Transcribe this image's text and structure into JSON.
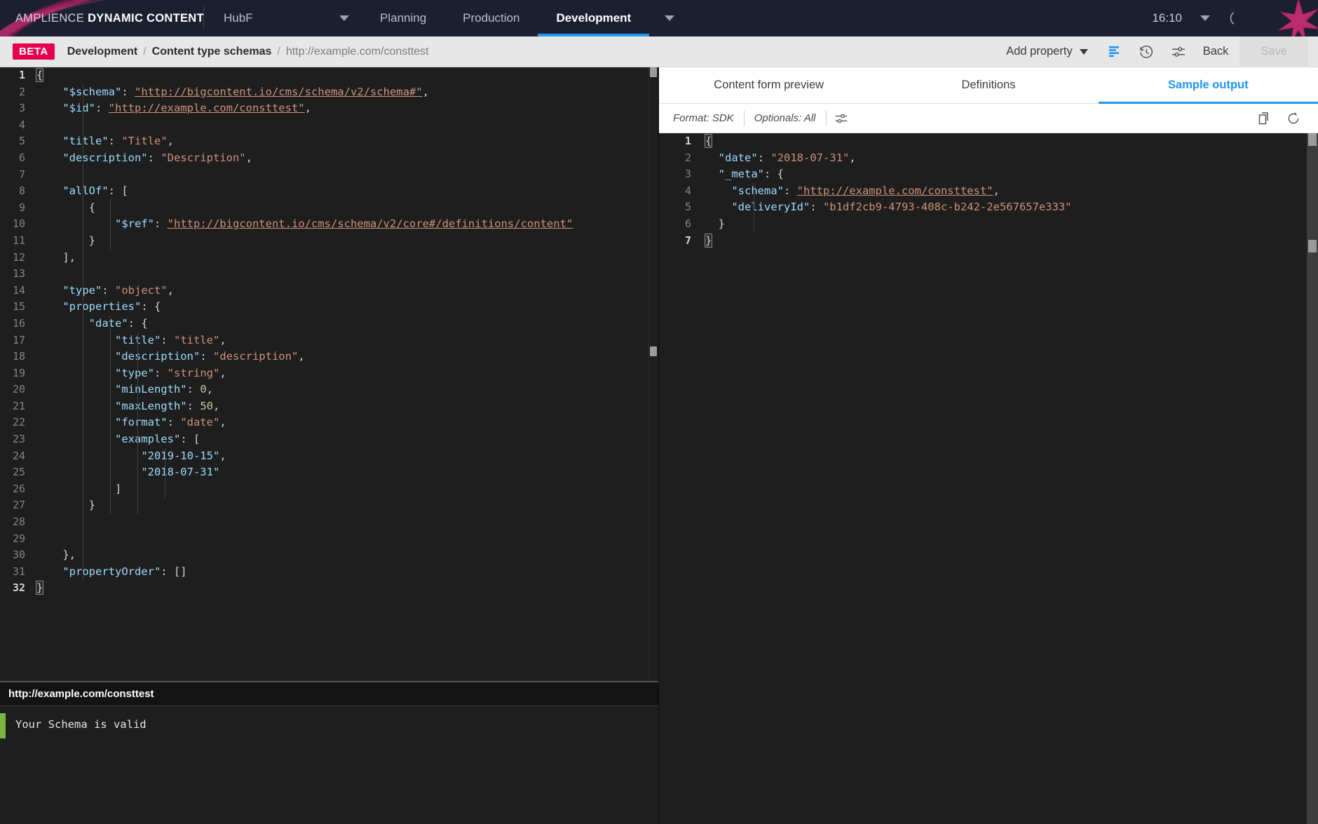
{
  "topbar": {
    "brand_light": "AMPLIENCE",
    "brand_bold": "DYNAMIC CONTENT",
    "hub_label": "HubF",
    "tabs": [
      {
        "label": "Planning",
        "active": false
      },
      {
        "label": "Production",
        "active": false
      },
      {
        "label": "Development",
        "active": true
      }
    ],
    "clock": "16:10",
    "icons": {
      "hub_caret": "chevron-down-icon",
      "tab_caret": "chevron-down-icon",
      "clock_caret": "chevron-down-icon",
      "help": "help-circle-icon",
      "settings": "gear-icon",
      "logout": "logout-icon"
    }
  },
  "actionbar": {
    "badge": "BETA",
    "breadcrumb": [
      {
        "label": "Development",
        "type": "link"
      },
      {
        "label": "Content type schemas",
        "type": "link"
      },
      {
        "label": "http://example.com/consttest",
        "type": "current"
      }
    ],
    "separator": "/",
    "add_property_label": "Add property",
    "back_label": "Back",
    "save_label": "Save",
    "icons": {
      "format": "format-indent-icon",
      "history": "history-clock-icon",
      "settings": "sliders-icon"
    },
    "accent_beta": "#e5004c",
    "accent_format_icon": "#2196f3"
  },
  "editor": {
    "language": "json",
    "total_lines": 32,
    "lines": [
      {
        "n": 1,
        "tokens": [
          {
            "t": "{",
            "c": "brkt"
          }
        ]
      },
      {
        "n": 2,
        "tokens": [
          {
            "t": "    ",
            "c": "p"
          },
          {
            "t": "\"$schema\"",
            "c": "k"
          },
          {
            "t": ": ",
            "c": "p"
          },
          {
            "t": "\"http://bigcontent.io/cms/schema/v2/schema#\"",
            "c": "su"
          },
          {
            "t": ",",
            "c": "p"
          }
        ]
      },
      {
        "n": 3,
        "tokens": [
          {
            "t": "    ",
            "c": "p"
          },
          {
            "t": "\"$id\"",
            "c": "k"
          },
          {
            "t": ": ",
            "c": "p"
          },
          {
            "t": "\"http://example.com/consttest\"",
            "c": "su"
          },
          {
            "t": ",",
            "c": "p"
          }
        ]
      },
      {
        "n": 4,
        "tokens": []
      },
      {
        "n": 5,
        "tokens": [
          {
            "t": "    ",
            "c": "p"
          },
          {
            "t": "\"title\"",
            "c": "k"
          },
          {
            "t": ": ",
            "c": "p"
          },
          {
            "t": "\"Title\"",
            "c": "s"
          },
          {
            "t": ",",
            "c": "p"
          }
        ]
      },
      {
        "n": 6,
        "tokens": [
          {
            "t": "    ",
            "c": "p"
          },
          {
            "t": "\"description\"",
            "c": "k"
          },
          {
            "t": ": ",
            "c": "p"
          },
          {
            "t": "\"Description\"",
            "c": "s"
          },
          {
            "t": ",",
            "c": "p"
          }
        ]
      },
      {
        "n": 7,
        "tokens": []
      },
      {
        "n": 8,
        "tokens": [
          {
            "t": "    ",
            "c": "p"
          },
          {
            "t": "\"allOf\"",
            "c": "k"
          },
          {
            "t": ": [",
            "c": "p"
          }
        ]
      },
      {
        "n": 9,
        "tokens": [
          {
            "t": "        {",
            "c": "p"
          }
        ]
      },
      {
        "n": 10,
        "tokens": [
          {
            "t": "            ",
            "c": "p"
          },
          {
            "t": "\"$ref\"",
            "c": "k"
          },
          {
            "t": ": ",
            "c": "p"
          },
          {
            "t": "\"http://bigcontent.io/cms/schema/v2/core#/definitions/content\"",
            "c": "su"
          }
        ]
      },
      {
        "n": 11,
        "tokens": [
          {
            "t": "        }",
            "c": "p"
          }
        ]
      },
      {
        "n": 12,
        "tokens": [
          {
            "t": "    ],",
            "c": "p"
          }
        ]
      },
      {
        "n": 13,
        "tokens": []
      },
      {
        "n": 14,
        "tokens": [
          {
            "t": "    ",
            "c": "p"
          },
          {
            "t": "\"type\"",
            "c": "k"
          },
          {
            "t": ": ",
            "c": "p"
          },
          {
            "t": "\"object\"",
            "c": "s"
          },
          {
            "t": ",",
            "c": "p"
          }
        ]
      },
      {
        "n": 15,
        "tokens": [
          {
            "t": "    ",
            "c": "p"
          },
          {
            "t": "\"properties\"",
            "c": "k"
          },
          {
            "t": ": {",
            "c": "p"
          }
        ]
      },
      {
        "n": 16,
        "tokens": [
          {
            "t": "        ",
            "c": "p"
          },
          {
            "t": "\"date\"",
            "c": "k"
          },
          {
            "t": ": {",
            "c": "p"
          }
        ]
      },
      {
        "n": 17,
        "tokens": [
          {
            "t": "            ",
            "c": "p"
          },
          {
            "t": "\"title\"",
            "c": "k"
          },
          {
            "t": ": ",
            "c": "p"
          },
          {
            "t": "\"title\"",
            "c": "s"
          },
          {
            "t": ",",
            "c": "p"
          }
        ]
      },
      {
        "n": 18,
        "tokens": [
          {
            "t": "            ",
            "c": "p"
          },
          {
            "t": "\"description\"",
            "c": "k"
          },
          {
            "t": ": ",
            "c": "p"
          },
          {
            "t": "\"description\"",
            "c": "s"
          },
          {
            "t": ",",
            "c": "p"
          }
        ]
      },
      {
        "n": 19,
        "tokens": [
          {
            "t": "            ",
            "c": "p"
          },
          {
            "t": "\"type\"",
            "c": "k"
          },
          {
            "t": ": ",
            "c": "p"
          },
          {
            "t": "\"string\"",
            "c": "s"
          },
          {
            "t": ",",
            "c": "p"
          }
        ]
      },
      {
        "n": 20,
        "tokens": [
          {
            "t": "            ",
            "c": "p"
          },
          {
            "t": "\"minLength\"",
            "c": "k"
          },
          {
            "t": ": ",
            "c": "p"
          },
          {
            "t": "0",
            "c": "n"
          },
          {
            "t": ",",
            "c": "p"
          }
        ]
      },
      {
        "n": 21,
        "tokens": [
          {
            "t": "            ",
            "c": "p"
          },
          {
            "t": "\"maxLength\"",
            "c": "k"
          },
          {
            "t": ": ",
            "c": "p"
          },
          {
            "t": "50",
            "c": "n"
          },
          {
            "t": ",",
            "c": "p"
          }
        ]
      },
      {
        "n": 22,
        "tokens": [
          {
            "t": "            ",
            "c": "p"
          },
          {
            "t": "\"format\"",
            "c": "k"
          },
          {
            "t": ": ",
            "c": "p"
          },
          {
            "t": "\"date\"",
            "c": "s"
          },
          {
            "t": ",",
            "c": "p"
          }
        ]
      },
      {
        "n": 23,
        "tokens": [
          {
            "t": "            ",
            "c": "p"
          },
          {
            "t": "\"examples\"",
            "c": "k"
          },
          {
            "t": ": [",
            "c": "p"
          }
        ]
      },
      {
        "n": 24,
        "tokens": [
          {
            "t": "                ",
            "c": "p"
          },
          {
            "t": "\"2019-10-15\"",
            "c": "sb"
          },
          {
            "t": ",",
            "c": "p"
          }
        ]
      },
      {
        "n": 25,
        "tokens": [
          {
            "t": "                ",
            "c": "p"
          },
          {
            "t": "\"2018-07-31\"",
            "c": "sb"
          }
        ]
      },
      {
        "n": 26,
        "tokens": [
          {
            "t": "            ]",
            "c": "p"
          }
        ]
      },
      {
        "n": 27,
        "tokens": [
          {
            "t": "        }",
            "c": "p"
          }
        ]
      },
      {
        "n": 28,
        "tokens": []
      },
      {
        "n": 29,
        "tokens": []
      },
      {
        "n": 30,
        "tokens": [
          {
            "t": "    },",
            "c": "p"
          }
        ]
      },
      {
        "n": 31,
        "tokens": [
          {
            "t": "    ",
            "c": "p"
          },
          {
            "t": "\"propertyOrder\"",
            "c": "k"
          },
          {
            "t": ": []",
            "c": "p"
          }
        ]
      },
      {
        "n": 32,
        "tokens": [
          {
            "t": "}",
            "c": "brkt"
          }
        ]
      }
    ]
  },
  "validation": {
    "header": "http://example.com/consttest",
    "message": "Your Schema is valid",
    "status_color": "#7cb342",
    "status": "valid"
  },
  "preview": {
    "tabs": [
      {
        "label": "Content form preview",
        "active": false
      },
      {
        "label": "Definitions",
        "active": false
      },
      {
        "label": "Sample output",
        "active": true
      }
    ],
    "toolbar": {
      "format_label": "Format: SDK",
      "optionals_label": "Optionals: All",
      "settings_icon": "sliders-icon",
      "copy_icon": "copy-icon",
      "refresh_icon": "refresh-icon"
    },
    "sample": {
      "total_lines": 7,
      "lines": [
        {
          "n": 1,
          "tokens": [
            {
              "t": "{",
              "c": "brkt"
            }
          ]
        },
        {
          "n": 2,
          "tokens": [
            {
              "t": "  ",
              "c": "p"
            },
            {
              "t": "\"date\"",
              "c": "k"
            },
            {
              "t": ": ",
              "c": "p"
            },
            {
              "t": "\"2018-07-31\"",
              "c": "s"
            },
            {
              "t": ",",
              "c": "p"
            }
          ]
        },
        {
          "n": 3,
          "tokens": [
            {
              "t": "  ",
              "c": "p"
            },
            {
              "t": "\"_meta\"",
              "c": "k"
            },
            {
              "t": ": {",
              "c": "p"
            }
          ]
        },
        {
          "n": 4,
          "tokens": [
            {
              "t": "    ",
              "c": "p"
            },
            {
              "t": "\"schema\"",
              "c": "k"
            },
            {
              "t": ": ",
              "c": "p"
            },
            {
              "t": "\"http://example.com/consttest\"",
              "c": "su"
            },
            {
              "t": ",",
              "c": "p"
            }
          ]
        },
        {
          "n": 5,
          "tokens": [
            {
              "t": "    ",
              "c": "p"
            },
            {
              "t": "\"deliveryId\"",
              "c": "k"
            },
            {
              "t": ": ",
              "c": "p"
            },
            {
              "t": "\"b1df2cb9-4793-408c-b242-2e567657e333\"",
              "c": "s"
            }
          ]
        },
        {
          "n": 6,
          "tokens": [
            {
              "t": "  }",
              "c": "p"
            }
          ]
        },
        {
          "n": 7,
          "tokens": [
            {
              "t": "}",
              "c": "brkt"
            }
          ]
        }
      ]
    }
  }
}
